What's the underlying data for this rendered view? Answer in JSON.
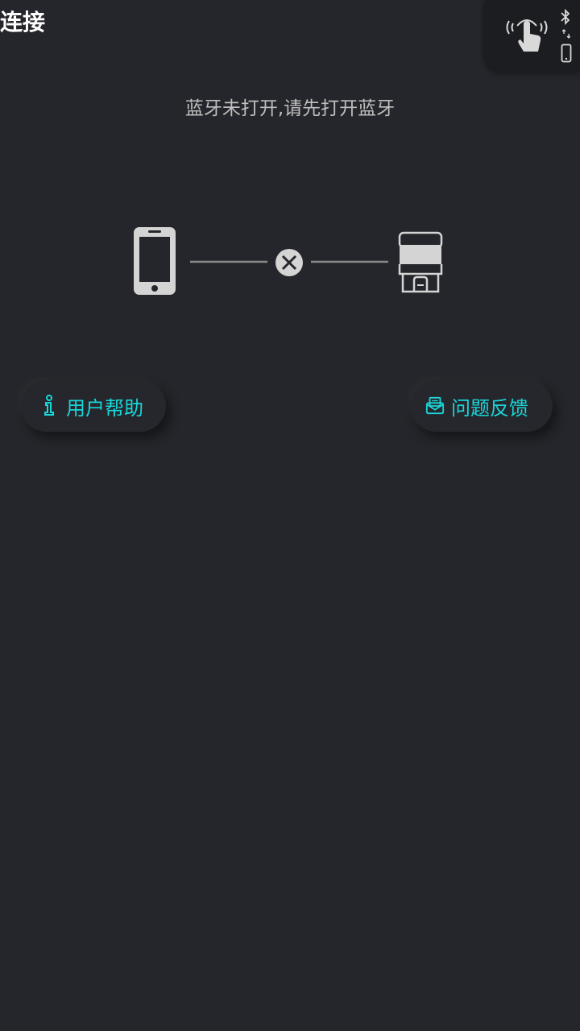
{
  "header": {
    "title": "连接"
  },
  "status": {
    "message": "蓝牙未打开,请先打开蓝牙"
  },
  "connection": {
    "left_device": "phone-icon",
    "state": "disconnected",
    "right_device": "obd-adapter-icon"
  },
  "actions": {
    "help_label": "用户帮助",
    "feedback_label": "问题反馈"
  },
  "colors": {
    "background": "#25262b",
    "accent": "#19d6d8",
    "text_muted": "#bfbfbf"
  }
}
